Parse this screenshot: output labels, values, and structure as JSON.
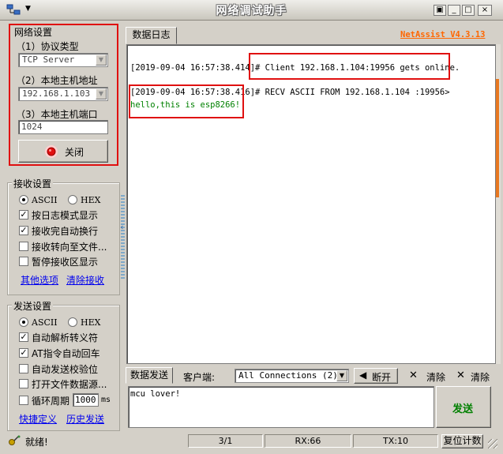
{
  "window": {
    "title": "网络调试助手",
    "system_menu_arrow": "▼",
    "controls": {
      "restore": "▣",
      "minimize": "_",
      "maximize": "□",
      "close": "×"
    }
  },
  "network": {
    "group_title": "网络设置",
    "protocol_label": "（1）协议类型",
    "protocol_value": "TCP Server",
    "host_label": "（2）本地主机地址",
    "host_value": "192.168.1.103",
    "port_label": "（3）本地主机端口",
    "port_value": "1024",
    "close_button": "关闭"
  },
  "receive": {
    "group_title": "接收设置",
    "ascii": "ASCII",
    "hex": "HEX",
    "opt_log_mode": "按日志模式显示",
    "opt_auto_wrap": "接收完自动换行",
    "opt_to_file": "接收转向至文件...",
    "opt_pause": "暂停接收区显示",
    "link_more": "其他选项",
    "link_clear": "清除接收"
  },
  "send": {
    "group_title": "发送设置",
    "ascii": "ASCII",
    "hex": "HEX",
    "opt_escape": "自动解析转义符",
    "opt_at": "AT指令自动回车",
    "opt_checksum": "自动发送校验位",
    "opt_file_source": "打开文件数据源...",
    "opt_cycle": "循环周期",
    "cycle_value": "1000",
    "cycle_unit": "ms",
    "link_shortcut": "快捷定义",
    "link_history": "历史发送"
  },
  "log": {
    "tab_label": "数据日志",
    "version": "NetAssist V4.3.13",
    "line1": "[2019-09-04 16:57:38.414]# Client 192.168.1.104:19956 gets online.",
    "line2": "[2019-09-04 16:57:38.416]# RECV ASCII FROM 192.168.1.104 :19956>",
    "line3": "hello,this is esp8266!"
  },
  "sendbar": {
    "tab_label": "数据发送",
    "client_label": "客户端:",
    "client_value": "All Connections (2)",
    "disconnect_button": "断开",
    "clear1": "清除",
    "clear2": "清除",
    "message": "mcu lover!",
    "send_button": "发送"
  },
  "status": {
    "ready": "就绪!",
    "count": "3/1",
    "rx": "RX:66",
    "tx": "TX:10",
    "reset": "复位计数"
  },
  "colors": {
    "highlight_red": "#e01010",
    "version_orange": "#ff6600",
    "received_green": "#008000",
    "send_green": "#008000",
    "scroll_accent": "#e87820"
  }
}
